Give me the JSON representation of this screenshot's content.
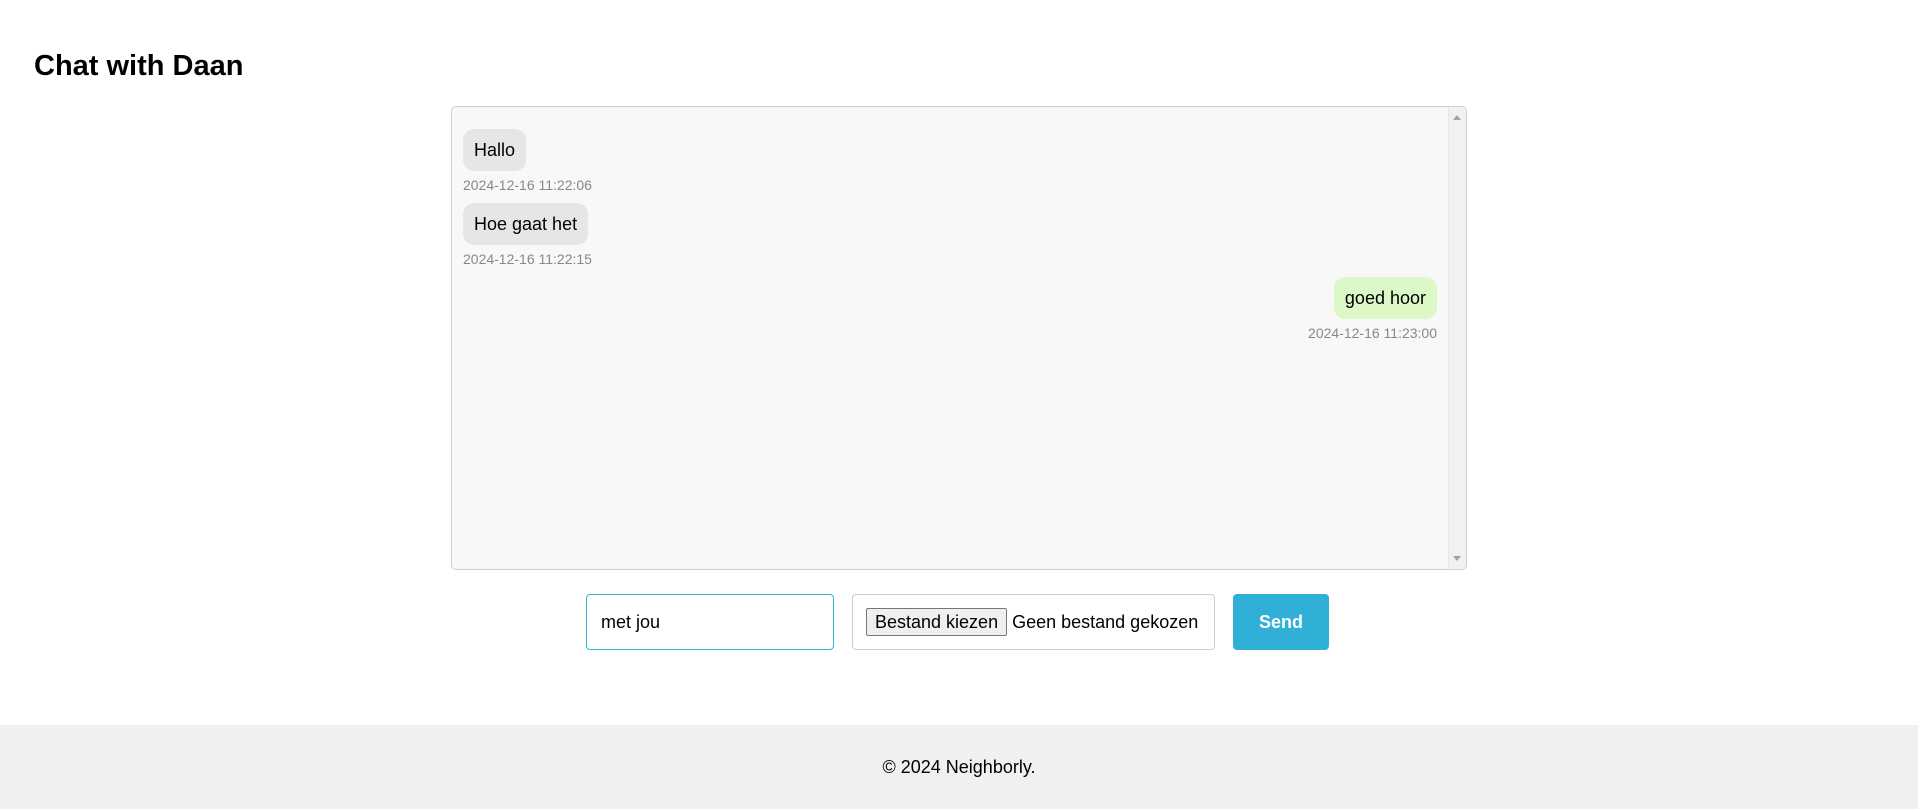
{
  "header": {
    "title": "Chat with Daan"
  },
  "chat": {
    "messages": [
      {
        "direction": "received",
        "text": "Hallo",
        "timestamp": "2024-12-16 11:22:06"
      },
      {
        "direction": "received",
        "text": "Hoe gaat het",
        "timestamp": "2024-12-16 11:22:15"
      },
      {
        "direction": "sent",
        "text": "goed hoor",
        "timestamp": "2024-12-16 11:23:00"
      }
    ]
  },
  "composer": {
    "message_value": "met jou",
    "file_button_label": "Bestand kiezen",
    "file_status": "Geen bestand gekozen",
    "send_label": "Send"
  },
  "footer": {
    "text": "© 2024 Neighborly."
  },
  "colors": {
    "accent": "#30b0d6",
    "received_bubble": "#e6e6e6",
    "sent_bubble": "#dcf8c6"
  },
  "icons": {
    "scroll_up": "scroll-up-arrow-icon",
    "scroll_down": "scroll-down-arrow-icon"
  }
}
